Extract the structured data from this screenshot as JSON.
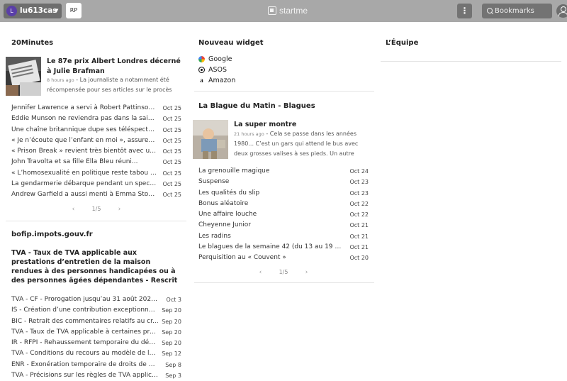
{
  "topbar": {
    "user_initial": "L",
    "user_name": "lu613cas",
    "rp_label": "RP",
    "logo_text": "startme",
    "search_placeholder": "Bookmarks"
  },
  "widget_20min": {
    "title": "20Minutes",
    "feature": {
      "title": "Le 87e prix Albert Londres décerné à Julie Brafman",
      "ago": "8 hours ago",
      "desc": "La journaliste a notamment été récompensée pour ses articles sur le procès celui"
    },
    "rows": [
      {
        "title": "Jennifer Lawrence a servi à Robert Pattinson ...",
        "date": "Oct 25"
      },
      {
        "title": "Eddie Munson ne reviendra pas dans la saiso...",
        "date": "Oct 25"
      },
      {
        "title": "Une chaîne britannique dupe ses téléspectat...",
        "date": "Oct 25"
      },
      {
        "title": "« Je n’écoute que l’enfant en moi », assure Yc...",
        "date": "Oct 25"
      },
      {
        "title": "« Prison Break » revient très bientôt avec un ...",
        "date": "Oct 25"
      },
      {
        "title": "John Travolta et sa fille Ella Bleu réuni...",
        "date": "Oct 25"
      },
      {
        "title": "« L’homosexualité en politique reste tabou », ...",
        "date": "Oct 25"
      },
      {
        "title": "La gendarmerie débarque pendant un spect...",
        "date": "Oct 25"
      },
      {
        "title": "Andrew Garfield a aussi menti à Emma Stone...",
        "date": "Oct 25"
      }
    ],
    "pager": "1/5"
  },
  "widget_bofip": {
    "title": "bofip.impots.gouv.fr",
    "feature_title": "TVA - Taux de TVA applicable aux prestations d’entretien de la maison rendues à des personnes handicapées ou à des personnes âgées dépendantes - Rescrit",
    "rows": [
      {
        "title": "TVA - CF - Prorogation jusqu’au 31 août 2026 d...",
        "date": "Oct 3"
      },
      {
        "title": "IS - Création d’une contribution exceptionnel...",
        "date": "Sep 20"
      },
      {
        "title": "BIC - Retrait des commentaires relatifs au cr...",
        "date": "Sep 20"
      },
      {
        "title": "TVA - Taux de TVA applicable à certaines pres...",
        "date": "Sep 20"
      },
      {
        "title": "IR - RFPI - Rehaussement temporaire du défi...",
        "date": "Sep 20"
      },
      {
        "title": "TVA - Conditions du recours au modèle de let...",
        "date": "Sep 12"
      },
      {
        "title": "ENR - Exonération temporaire de droits de m...",
        "date": "Sep 8"
      },
      {
        "title": "TVA - Précisions sur les règles de TVA applicab...",
        "date": "Sep 3"
      }
    ]
  },
  "widget_links": {
    "title": "Nouveau widget",
    "links": [
      {
        "label": "Google",
        "icon": "google-icon"
      },
      {
        "label": "ASOS",
        "icon": "asos-icon"
      },
      {
        "label": "Amazon",
        "icon": "amazon-icon"
      }
    ]
  },
  "widget_blague": {
    "title": "La Blague du Matin - Blagues",
    "feature": {
      "title": "La super montre",
      "ago": "21 hours ago",
      "desc": "Cela se passe dans les années 1980... C’est un gars qui attend le bus avec deux grosses valises à ses pieds. Un autre arrive et lui demande"
    },
    "rows": [
      {
        "title": "La grenouille magique",
        "date": "Oct 24"
      },
      {
        "title": "Suspense",
        "date": "Oct 23"
      },
      {
        "title": "Les qualités du slip",
        "date": "Oct 23"
      },
      {
        "title": "Bonus aléatoire",
        "date": "Oct 22"
      },
      {
        "title": "Une affaire louche",
        "date": "Oct 22"
      },
      {
        "title": "Cheyenne Junior",
        "date": "Oct 21"
      },
      {
        "title": "Les radins",
        "date": "Oct 21"
      },
      {
        "title": "Le blagues de la semaine 42 (du 13 au 19 oct...",
        "date": "Oct 21"
      },
      {
        "title": "Perquisition au « Couvent »",
        "date": "Oct 20"
      }
    ],
    "pager": "1/5"
  },
  "widget_equipe": {
    "title": "L’Équipe"
  }
}
